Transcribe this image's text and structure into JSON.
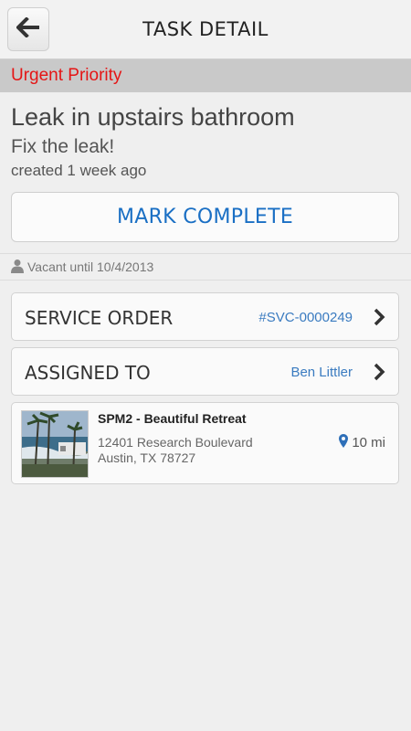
{
  "header": {
    "title": "TASK DETAIL",
    "back_icon": "back-arrow-icon"
  },
  "task": {
    "priority": "Urgent Priority",
    "title": "Leak in upstairs bathroom",
    "description": "Fix the leak!",
    "created": "created 1 week ago",
    "mark_complete_label": "MARK COMPLETE"
  },
  "vacancy": {
    "text": "Vacant until 10/4/2013",
    "icon": "person-icon"
  },
  "service_order": {
    "label": "SERVICE ORDER",
    "value": "#SVC-0000249"
  },
  "assigned_to": {
    "label": "ASSIGNED TO",
    "value": "Ben Littler"
  },
  "property": {
    "name": "SPM2 - Beautiful Retreat",
    "address_line1": "12401 Research Boulevard",
    "address_line2": "Austin, TX 78727",
    "distance": "10 mi",
    "distance_icon": "map-pin-icon"
  },
  "colors": {
    "priority_red": "#e51515",
    "accent_blue": "#1a6fc4",
    "link_blue": "#3a7bc0",
    "priority_bar_bg": "#c9c9c9"
  }
}
